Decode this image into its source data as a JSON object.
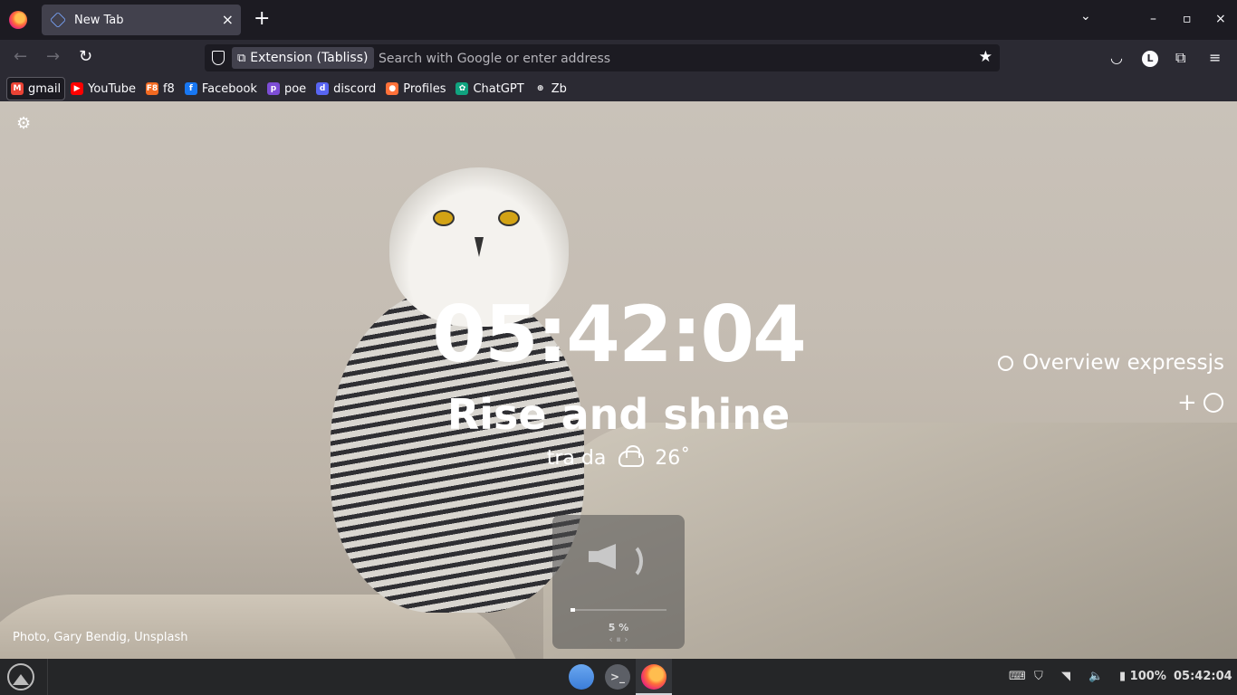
{
  "tabs": [
    {
      "title": "New Tab",
      "close": "×"
    }
  ],
  "tabstrip": {
    "new_tab": "+",
    "list_all": "⌄",
    "minimize": "–",
    "maximize": "▫",
    "close": "×"
  },
  "nav": {
    "back": "←",
    "forward": "→",
    "reload": "↻",
    "identity_label": "Extension (Tabliss)",
    "url_placeholder": "Search with Google or enter address",
    "url_value": "",
    "star": "★",
    "pocket": "◡",
    "account_initial": "L",
    "extensions": "⧉",
    "menu": "≡"
  },
  "bookmarks": [
    {
      "label": "gmail",
      "icon": "gmail-icon",
      "badge": "M",
      "color": "#ea4335",
      "active": true
    },
    {
      "label": "YouTube",
      "icon": "youtube-icon",
      "badge": "▶",
      "color": "#ff0000"
    },
    {
      "label": "f8",
      "icon": "f8-icon",
      "badge": "F8",
      "color": "#f26a21"
    },
    {
      "label": "Facebook",
      "icon": "facebook-icon",
      "badge": "f",
      "color": "#1877f2"
    },
    {
      "label": "poe",
      "icon": "poe-icon",
      "badge": "p",
      "color": "#7d4dd6"
    },
    {
      "label": "discord",
      "icon": "discord-icon",
      "badge": "d",
      "color": "#5865f2"
    },
    {
      "label": "Profiles",
      "icon": "firefox-icon",
      "badge": "●",
      "color": "#ff7139"
    },
    {
      "label": "ChatGPT",
      "icon": "chatgpt-icon",
      "badge": "✿",
      "color": "#10a37f"
    },
    {
      "label": "Zb",
      "icon": "globe-icon",
      "badge": "⊕",
      "color": "#2b2a33"
    }
  ],
  "dashboard": {
    "settings_icon": "⚙",
    "time": "05:42:04",
    "greeting": "Rise and shine",
    "weather_location": "tra da",
    "weather_icon": "cloud-icon",
    "temperature": "26˚",
    "todo_items": [
      "Overview expressjs"
    ],
    "todo_add": "+",
    "credit": "Photo, Gary Bendig, Unsplash"
  },
  "volume_osd": {
    "level_fraction": 0.05,
    "label": "5 %",
    "arrows": "‹ ⏸ ›"
  },
  "taskbar": {
    "terminal_glyph": ">_",
    "tray_keyboard": "⌨",
    "tray_shield": "⛉",
    "tray_wifi": "◥",
    "tray_volume": "🔈",
    "battery": "▮ 100%",
    "clock": "05:42:04"
  }
}
